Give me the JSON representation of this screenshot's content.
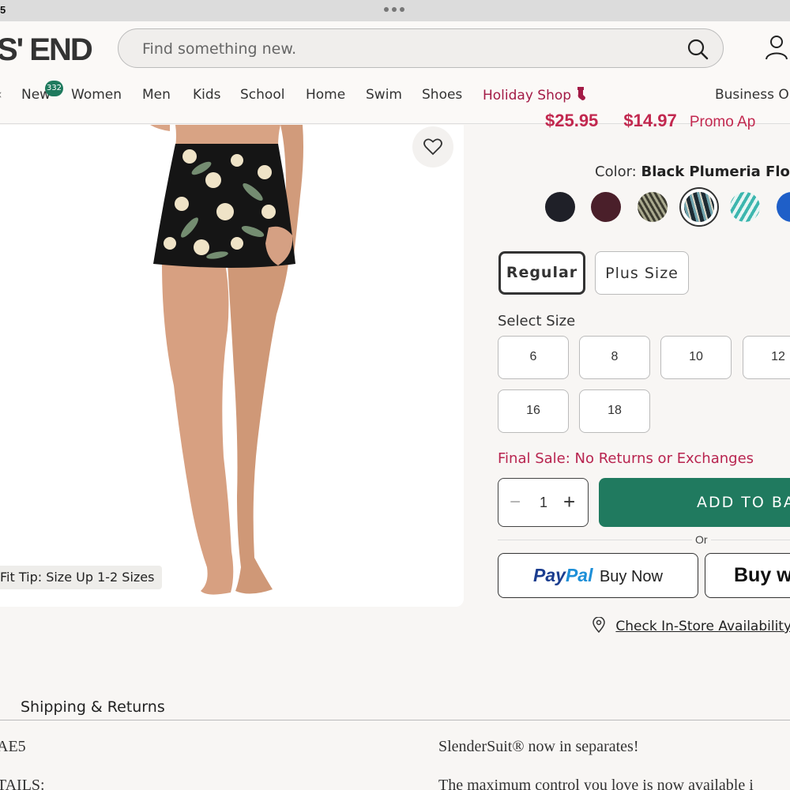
{
  "status_bar": {
    "time": "5"
  },
  "header": {
    "logo": "S' END",
    "search_placeholder": "Find something new.",
    "nav": [
      {
        "label": "New",
        "badge": "332"
      },
      {
        "label": "Women"
      },
      {
        "label": "Men"
      },
      {
        "label": "Kids"
      },
      {
        "label": "School"
      },
      {
        "label": "Home"
      },
      {
        "label": "Swim"
      },
      {
        "label": "Shoes"
      },
      {
        "label": "Holiday Shop",
        "accent": "#a31b46"
      },
      {
        "label": "Business Ou"
      }
    ]
  },
  "product": {
    "fit_tip": "Fit Tip: Size Up 1-2 Sizes",
    "price_original": "$25.95",
    "price_sale": "$14.97",
    "price_note": "Promo Ap",
    "color_label": "Color:",
    "color_name": "Black Plumeria Flor",
    "swatches": [
      {
        "name": "black",
        "color": "#1f2028"
      },
      {
        "name": "plum",
        "color": "#4a1f2a"
      },
      {
        "name": "animal-print",
        "color": "#6b6a58"
      },
      {
        "name": "black-plumeria-floral",
        "color": "#2a4048",
        "selected": true
      },
      {
        "name": "teal-wave",
        "color": "#6fc9c3"
      },
      {
        "name": "blue",
        "color": "#1f5fc8"
      }
    ],
    "fit_options": [
      "Regular",
      "Plus Size"
    ],
    "size_label": "Select Size",
    "sizes": [
      "6",
      "8",
      "10",
      "12",
      "16",
      "18"
    ],
    "final_sale": "Final Sale: No Returns or Exchanges",
    "quantity": "1",
    "add_to_bag": "ADD TO BA",
    "or": "Or",
    "paypal_brand_1": "Pay",
    "paypal_brand_2": "Pal",
    "paypal_buy_now": "Buy Now",
    "buy_with": "Buy w",
    "store_link": "Check In-Store Availability"
  },
  "bottom": {
    "tab": "Shipping & Returns",
    "code": "AE5",
    "details_label": "TAILS:",
    "promo_head": "SlenderSuit® now in separates!",
    "promo_body": "The maximum control you love is now available i"
  },
  "colors": {
    "accent_green": "#207a5f",
    "sale_red": "#c2284f",
    "paypal_dark": "#1b3d8f",
    "paypal_light": "#1d8fd8"
  }
}
